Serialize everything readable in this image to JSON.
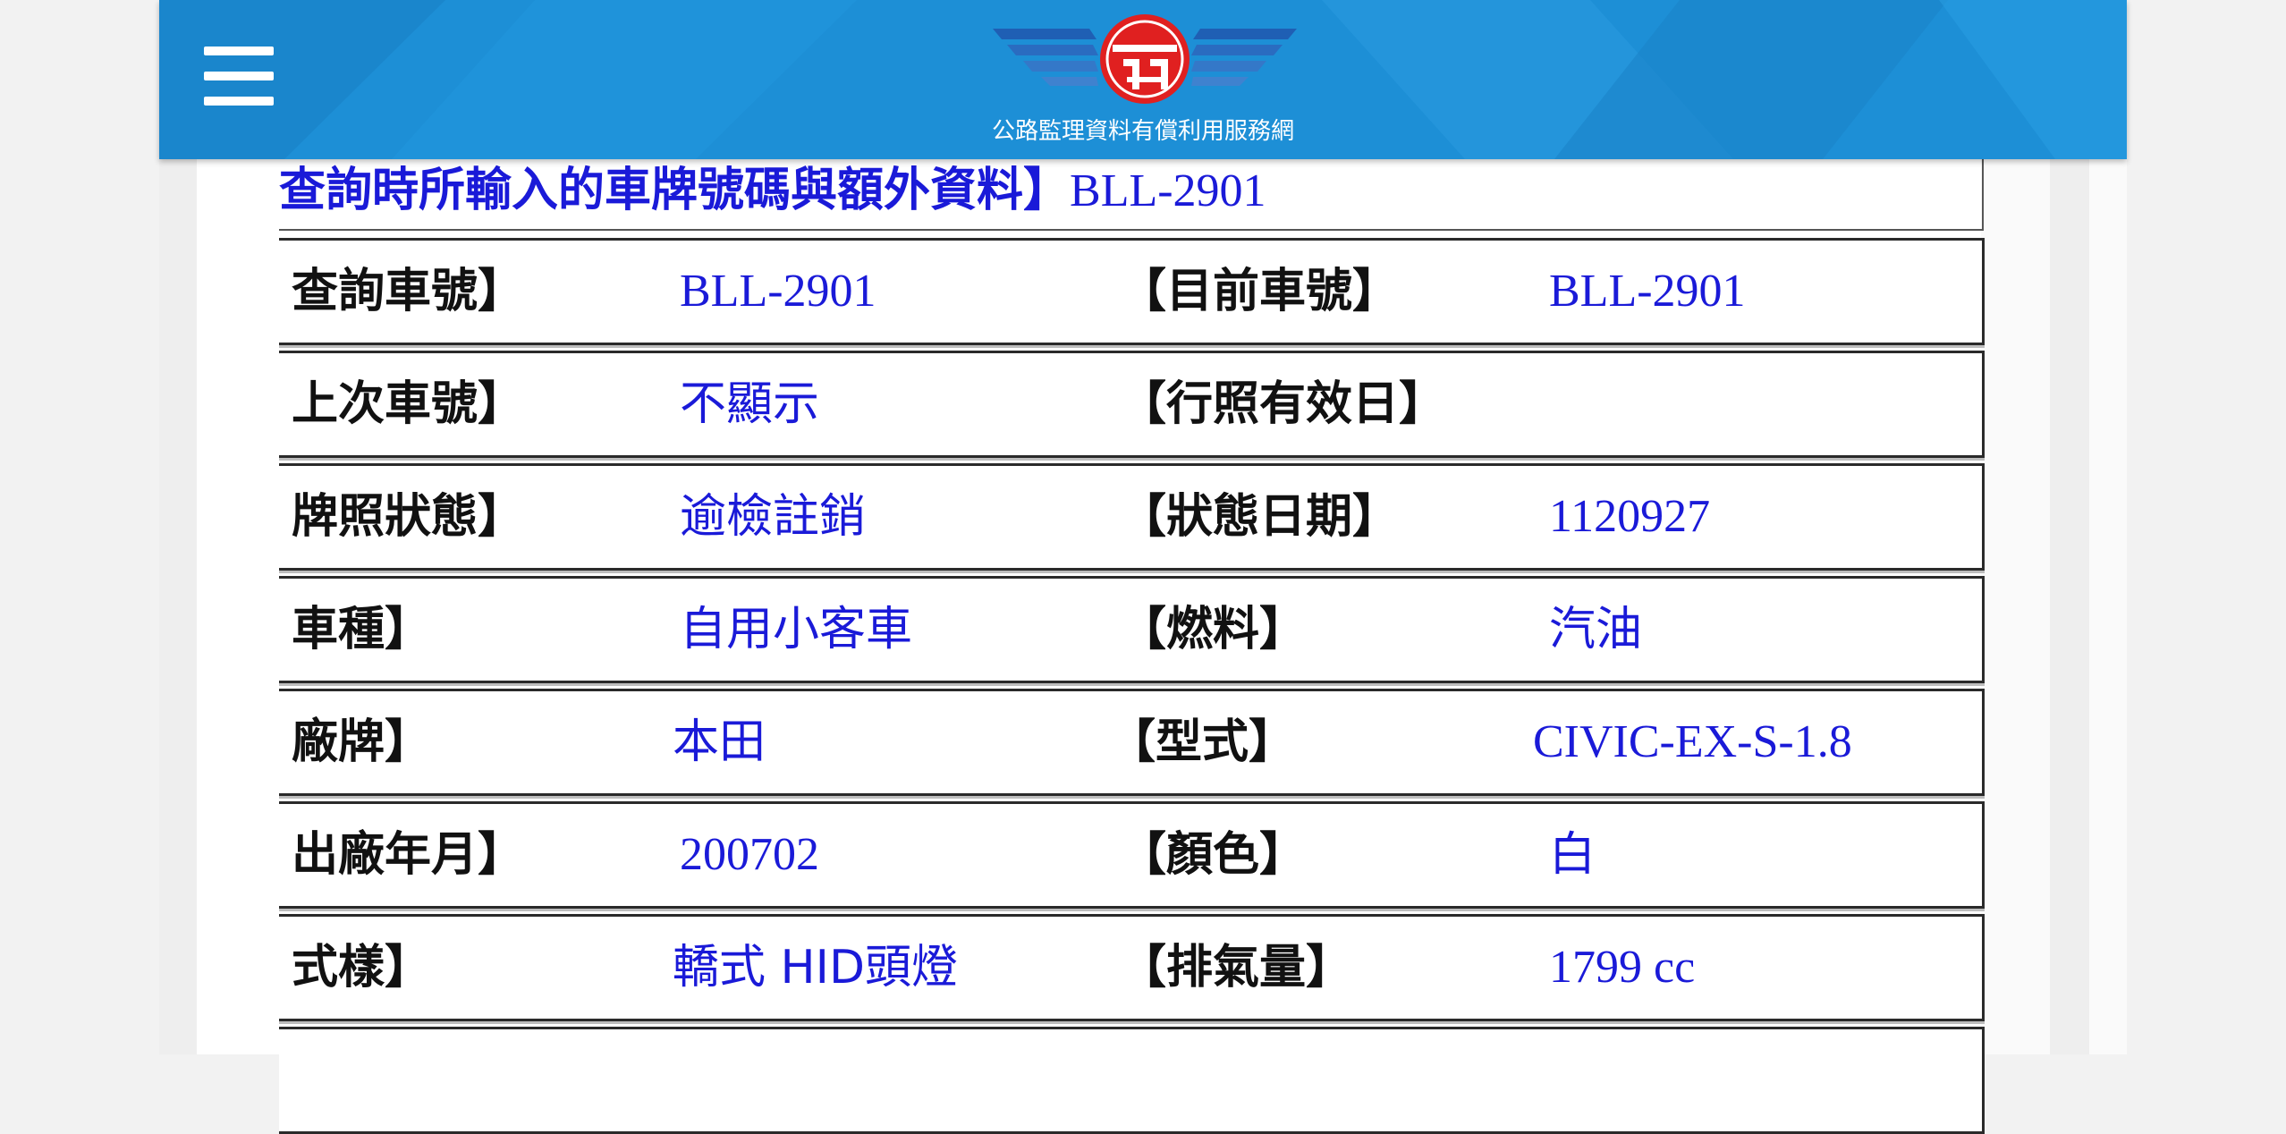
{
  "header": {
    "site_title": "公路監理資料有償利用服務網",
    "menu_icon": "hamburger-menu-icon",
    "logo_icon": "winged-emblem-logo",
    "colors": {
      "bar": "#1d8fd6",
      "logo_red": "#e02020",
      "logo_blue": "#1f5fb4"
    }
  },
  "table": {
    "caption_label": "查詢時所輸入的車牌號碼與額外資料】",
    "caption_value": "BLL-2901",
    "rows": [
      {
        "label1": "查詢車號】",
        "value1": "BLL-2901",
        "label2": "【目前車號】",
        "value2": "BLL-2901"
      },
      {
        "label1": "上次車號】",
        "value1": "不顯示",
        "label2": "【行照有效日】",
        "value2": ""
      },
      {
        "label1": "牌照狀態】",
        "value1": "逾檢註銷",
        "label2": "【狀態日期】",
        "value2": "1120927"
      },
      {
        "label1": "車種】",
        "value1": "自用小客車",
        "label2": "【燃料】",
        "value2": "汽油"
      },
      {
        "label1": "廠牌】",
        "value1": "本田",
        "label2": "【型式】",
        "value2": "CIVIC-EX-S-1.8"
      },
      {
        "label1": "出廠年月】",
        "value1": "200702",
        "label2": "【顏色】",
        "value2": "白"
      },
      {
        "label1": "式樣】",
        "value1": "轎式 HID頭燈",
        "label2": "【排氣量】",
        "value2": "1799 cc"
      }
    ],
    "colors": {
      "label": "#111111",
      "value": "#1a1ad8",
      "border": "#2a2a2a"
    }
  }
}
